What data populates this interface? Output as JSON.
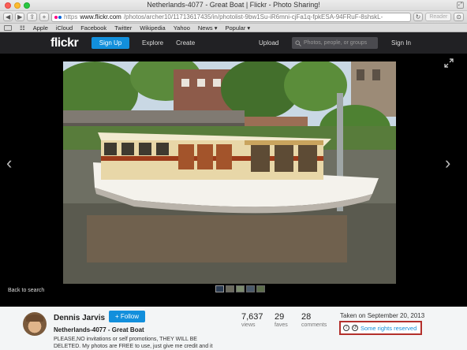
{
  "browser": {
    "window_title": "Netherlands-4077 - Great Boat | Flickr - Photo Sharing!",
    "url_scheme": "https",
    "url_host": "www.flickr.com",
    "url_path": "/photos/archer10/11713617435/in/photolist-9bw1Su-iR6mni-cjFa1q-fpkESA-94FRuF-8shskL-",
    "reader_label": "Reader",
    "bookmarks": [
      "Apple",
      "iCloud",
      "Facebook",
      "Twitter",
      "Wikipedia",
      "Yahoo",
      "News ▾",
      "Popular ▾"
    ]
  },
  "nav": {
    "logo": "flickr",
    "signup_label": "Sign Up",
    "explore_label": "Explore",
    "create_label": "Create",
    "upload_label": "Upload",
    "search_placeholder": "Photos, people, or groups",
    "signin_label": "Sign In"
  },
  "viewer": {
    "back_label": "Back to search",
    "thumb_count": 5
  },
  "info": {
    "username": "Dennis Jarvis",
    "follow_label": "+ Follow",
    "photo_title": "Netherlands-4077 - Great Boat",
    "description": "PLEASE,NO invitations or self promotions, THEY WILL BE DELETED. My photos are FREE to use, just give me credit and it",
    "views": "7,637",
    "views_label": "views",
    "faves": "29",
    "faves_label": "faves",
    "comments": "28",
    "comments_label": "comments",
    "taken": "Taken on September 20, 2013",
    "rights": "Some rights reserved"
  },
  "colors": {
    "accent": "#128fdc",
    "highlight_border": "#b3302c"
  }
}
